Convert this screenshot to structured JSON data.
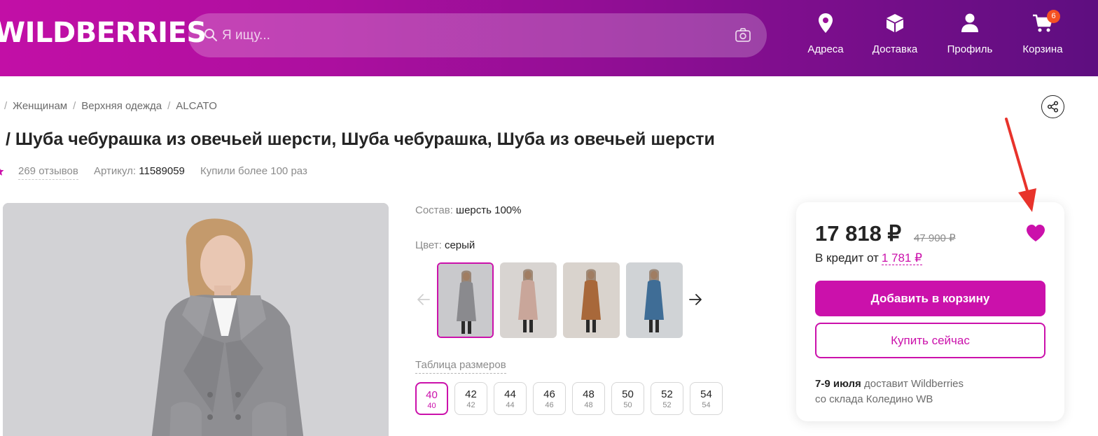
{
  "header": {
    "logo": "WILDBERRIES",
    "search_placeholder": "Я ищу...",
    "nav": [
      {
        "label": "Адреса",
        "icon": "location-pin-icon"
      },
      {
        "label": "Доставка",
        "icon": "box-icon"
      },
      {
        "label": "Профиль",
        "icon": "user-icon"
      },
      {
        "label": "Корзина",
        "icon": "cart-icon",
        "badge": "6"
      }
    ]
  },
  "breadcrumb": [
    "Женщинам",
    "Верхняя одежда",
    "ALCATO"
  ],
  "product": {
    "title": "/ Шуба чебурашка из овечьей шерсти, Шуба чебурашка, Шуба из овечьей шерсти",
    "reviews": "269 отзывов",
    "article_label": "Артикул:",
    "article_value": "11589059",
    "bought": "Купили более 100 раз",
    "composition_label": "Состав:",
    "composition_value": "шерсть 100%",
    "color_label": "Цвет:",
    "color_value": "серый",
    "color_thumbs": [
      {
        "name": "gray",
        "coat": "#8a8a8e",
        "bg": "#c9c9cc",
        "active": true
      },
      {
        "name": "beige",
        "coat": "#c9a69a",
        "bg": "#d8d4d1",
        "active": false
      },
      {
        "name": "brown",
        "coat": "#a8683a",
        "bg": "#d9d3cd",
        "active": false
      },
      {
        "name": "blue",
        "coat": "#3f6d96",
        "bg": "#d0d3d6",
        "active": false
      }
    ],
    "size_table_label": "Таблица размеров",
    "sizes": [
      {
        "main": "40",
        "sub": "40",
        "selected": true
      },
      {
        "main": "42",
        "sub": "42",
        "selected": false
      },
      {
        "main": "44",
        "sub": "44",
        "selected": false
      },
      {
        "main": "46",
        "sub": "46",
        "selected": false
      },
      {
        "main": "48",
        "sub": "48",
        "selected": false
      },
      {
        "main": "50",
        "sub": "50",
        "selected": false
      },
      {
        "main": "52",
        "sub": "52",
        "selected": false
      },
      {
        "main": "54",
        "sub": "54",
        "selected": false
      }
    ]
  },
  "card": {
    "price": "17 818 ₽",
    "old_price": "47 900 ₽",
    "credit_label": "В кредит от",
    "credit_value": "1 781 ₽",
    "add_to_cart": "Добавить в корзину",
    "buy_now": "Купить сейчас",
    "delivery_date": "7-9 июля",
    "delivery_text": "доставит Wildberries",
    "delivery_from": "со склада Коледино WB"
  },
  "colors": {
    "brand": "#cb11ab",
    "text": "#242424",
    "muted": "#8b8b8b",
    "arrow": "#e8332b"
  }
}
